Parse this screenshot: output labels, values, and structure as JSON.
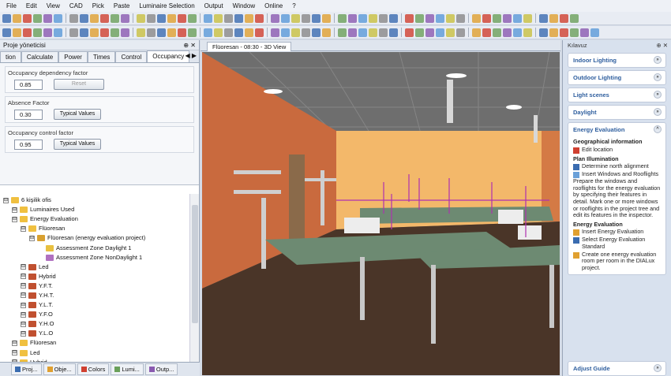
{
  "menu": [
    "File",
    "Edit",
    "View",
    "CAD",
    "Pick",
    "Paste",
    "Luminaire Selection",
    "Output",
    "Window",
    "Online",
    "?"
  ],
  "left": {
    "title": "Proje yöneticisi",
    "tabs": [
      "tion",
      "Calculate",
      "Power",
      "Times",
      "Control",
      "Occupancy"
    ],
    "occupancy": {
      "dep_label": "Occupancy dependency factor",
      "dep_value": "0.85",
      "reset": "Reset",
      "abs_label": "Absence Factor",
      "abs_value": "0.30",
      "typ1": "Typical Values",
      "ctrl_label": "Occupancy control factor",
      "ctrl_value": "0.95",
      "typ2": "Typical Values"
    },
    "tree": [
      {
        "d": 0,
        "t": "6 kişilik ofis",
        "c": "#f0c040"
      },
      {
        "d": 1,
        "t": "Luminaires Used",
        "c": "#f0c040"
      },
      {
        "d": 1,
        "t": "Energy Evaluation",
        "c": "#f0c040"
      },
      {
        "d": 2,
        "t": "Flüoresan",
        "c": "#f0c040"
      },
      {
        "d": 3,
        "t": "Flüoresan (energy evaluation project)",
        "c": "#d8a030"
      },
      {
        "d": 4,
        "t": "Assessment Zone Daylight 1",
        "c": "#e8c040"
      },
      {
        "d": 4,
        "t": "Assessment Zone NonDaylight 1",
        "c": "#b070c0"
      },
      {
        "d": 2,
        "t": "Led",
        "c": "#c05030"
      },
      {
        "d": 2,
        "t": "Hybrid",
        "c": "#c05030"
      },
      {
        "d": 2,
        "t": "Y.F.T.",
        "c": "#c05030"
      },
      {
        "d": 2,
        "t": "Y.H.T.",
        "c": "#c05030"
      },
      {
        "d": 2,
        "t": "Y.L.T.",
        "c": "#c05030"
      },
      {
        "d": 2,
        "t": "Y.F.O",
        "c": "#c05030"
      },
      {
        "d": 2,
        "t": "Y.H.O",
        "c": "#c05030"
      },
      {
        "d": 2,
        "t": "Y.L.O",
        "c": "#c05030"
      },
      {
        "d": 1,
        "t": "Flüoresan",
        "c": "#f0c040"
      },
      {
        "d": 1,
        "t": "Led",
        "c": "#f0c040"
      },
      {
        "d": 1,
        "t": "Hybrid",
        "c": "#f0c040"
      }
    ],
    "bottom_tabs": [
      "Proj...",
      "Obje...",
      "Colors",
      "Lumi...",
      "Outp..."
    ]
  },
  "viewtab": "Flüoresan - 08:30 - 3D View",
  "right": {
    "title": "Kılavuz",
    "cards": [
      "Indoor Lighting",
      "Outdoor Lighting",
      "Light scenes",
      "Daylight"
    ],
    "energy": {
      "title": "Energy Evaluation",
      "geo": "Geographical information",
      "edit": "Edit location",
      "plan": "Plan Illumination",
      "north": "Determine north alignment",
      "insert": "Insert Windows and Rooflights",
      "desc": "Prepare the windows and rooflights for the energy evaluation by specifying their features in detail. Mark one or more windows or rooflights in the project tree and edit its features in the inspector.",
      "ee": "Energy Evaluation",
      "ins_ee": "Insert Energy Evaluation",
      "sel": "Select Energy Evaluation Standard",
      "create": "Create one energy evaluation room per room in the DIALux project."
    },
    "adjust": "Adjust Guide"
  },
  "colors": {
    "accent": "#2e5e9e",
    "wall_orange": "#c96a3e",
    "wall_yellow": "#f3b86a",
    "desk": "#6d8a72",
    "floor": "#4a3528"
  }
}
